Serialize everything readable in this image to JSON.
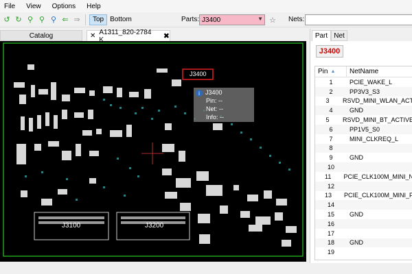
{
  "menu": [
    "File",
    "View",
    "Options",
    "Help"
  ],
  "toolbar": {
    "icons": [
      "rotate-left-icon",
      "rotate-right-icon",
      "zoom-in-icon",
      "zoom-out-icon",
      "zoom-fit-icon",
      "back-arrow-icon",
      "forward-arrow-icon"
    ],
    "top_label": "Top",
    "bottom_label": "Bottom",
    "parts_label": "Parts:",
    "parts_value": "J3400",
    "nets_label": "Nets:"
  },
  "tabs": {
    "catalog": "Catalog",
    "board": "A1311_820-2784 K..."
  },
  "board": {
    "selected_label": "J3400",
    "tooltip": {
      "title": "J3400",
      "pin": "Pin: --",
      "net": "Net: --",
      "info": "Info: --"
    },
    "component_labels": [
      "J3100",
      "J3200"
    ]
  },
  "panel": {
    "tabs": [
      "Part",
      "Net"
    ],
    "part_name": "J3400",
    "columns": [
      "Pin",
      "NetName"
    ],
    "rows": [
      {
        "pin": "1",
        "net": "PCIE_WAKE_L"
      },
      {
        "pin": "2",
        "net": "PP3V3_S3"
      },
      {
        "pin": "3",
        "net": "RSVD_MINI_WLAN_ACT"
      },
      {
        "pin": "4",
        "net": "GND"
      },
      {
        "pin": "5",
        "net": "RSVD_MINI_BT_ACTIVE"
      },
      {
        "pin": "6",
        "net": "PP1V5_S0"
      },
      {
        "pin": "7",
        "net": "MINI_CLKREQ_L"
      },
      {
        "pin": "8",
        "net": ""
      },
      {
        "pin": "9",
        "net": "GND"
      },
      {
        "pin": "10",
        "net": ""
      },
      {
        "pin": "11",
        "net": "PCIE_CLK100M_MINI_N"
      },
      {
        "pin": "12",
        "net": ""
      },
      {
        "pin": "13",
        "net": "PCIE_CLK100M_MINI_P"
      },
      {
        "pin": "14",
        "net": ""
      },
      {
        "pin": "15",
        "net": "GND"
      },
      {
        "pin": "16",
        "net": ""
      },
      {
        "pin": "17",
        "net": ""
      },
      {
        "pin": "18",
        "net": "GND"
      },
      {
        "pin": "19",
        "net": ""
      }
    ]
  },
  "colors": {
    "board_bg": "#000000",
    "board_outline": "#1fa31f",
    "selected_highlight": "#e02020",
    "parts_combo_bg": "#f7b8c7",
    "part_name_color": "#d40000"
  }
}
